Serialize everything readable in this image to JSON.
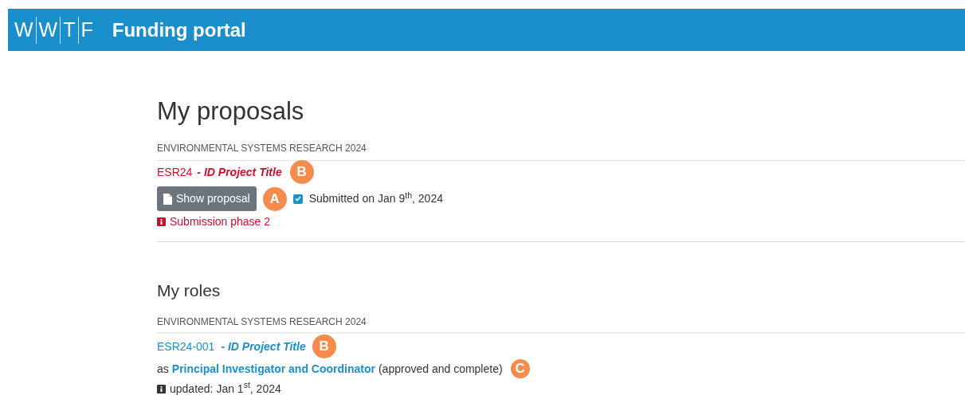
{
  "header": {
    "logo": [
      "W",
      "W",
      "T",
      "F"
    ],
    "title": "Funding portal"
  },
  "proposals": {
    "heading": "My proposals",
    "programme": "ENVIRONMENTAL SYSTEMS RESEARCH 2024",
    "id": "ESR24",
    "title": "- ID Project Title",
    "title_badge": "B",
    "button": "Show proposal",
    "button_badge": "A",
    "submitted": {
      "checked": true,
      "text": "Submitted on Jan 9$^{th}$, 2024"
    },
    "phase": "Submission phase 2"
  },
  "roles": {
    "heading": "My roles",
    "programme": "ENVIRONMENTAL SYSTEMS RESEARCH 2024",
    "id": "ESR24-001",
    "title": "- ID Project Title",
    "title_badge": "B",
    "prefix": "as",
    "role": "Principal Investigator and Coordinator",
    "role_badge": "C",
    "status": "(approved and complete)",
    "updated": "updated: Jan 1$^{st}$, 2024"
  }
}
